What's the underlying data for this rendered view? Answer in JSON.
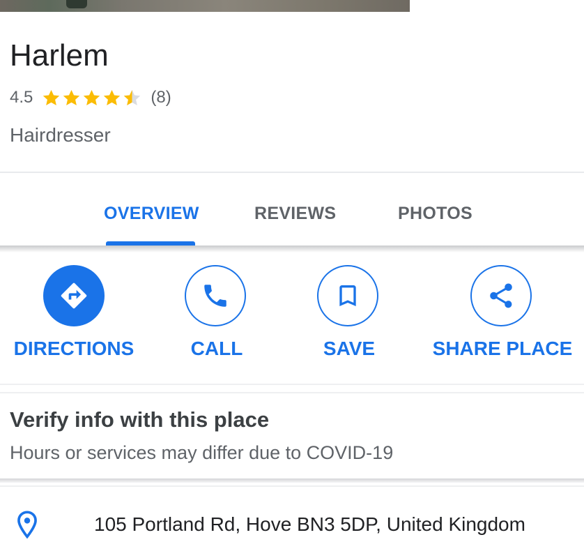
{
  "place": {
    "name": "Harlem",
    "rating": "4.5",
    "rating_value": 4.5,
    "review_count": "(8)",
    "category": "Hairdresser"
  },
  "tabs": [
    {
      "label": "OVERVIEW",
      "active": true
    },
    {
      "label": "REVIEWS",
      "active": false
    },
    {
      "label": "PHOTOS",
      "active": false
    }
  ],
  "actions": [
    {
      "label": "DIRECTIONS",
      "icon": "directions-icon"
    },
    {
      "label": "CALL",
      "icon": "phone-icon"
    },
    {
      "label": "SAVE",
      "icon": "bookmark-icon"
    },
    {
      "label": "SHARE PLACE",
      "icon": "share-icon"
    }
  ],
  "notice": {
    "title": "Verify info with this place",
    "subtitle": "Hours or services may differ due to COVID-19"
  },
  "address": {
    "text": "105 Portland Rd, Hove BN3 5DP, United Kingdom",
    "icon": "location-pin-icon"
  },
  "colors": {
    "accent": "#1a73e8",
    "star": "#fbbc04",
    "star_empty": "#dadce0",
    "secondary_text": "#5f6368"
  }
}
